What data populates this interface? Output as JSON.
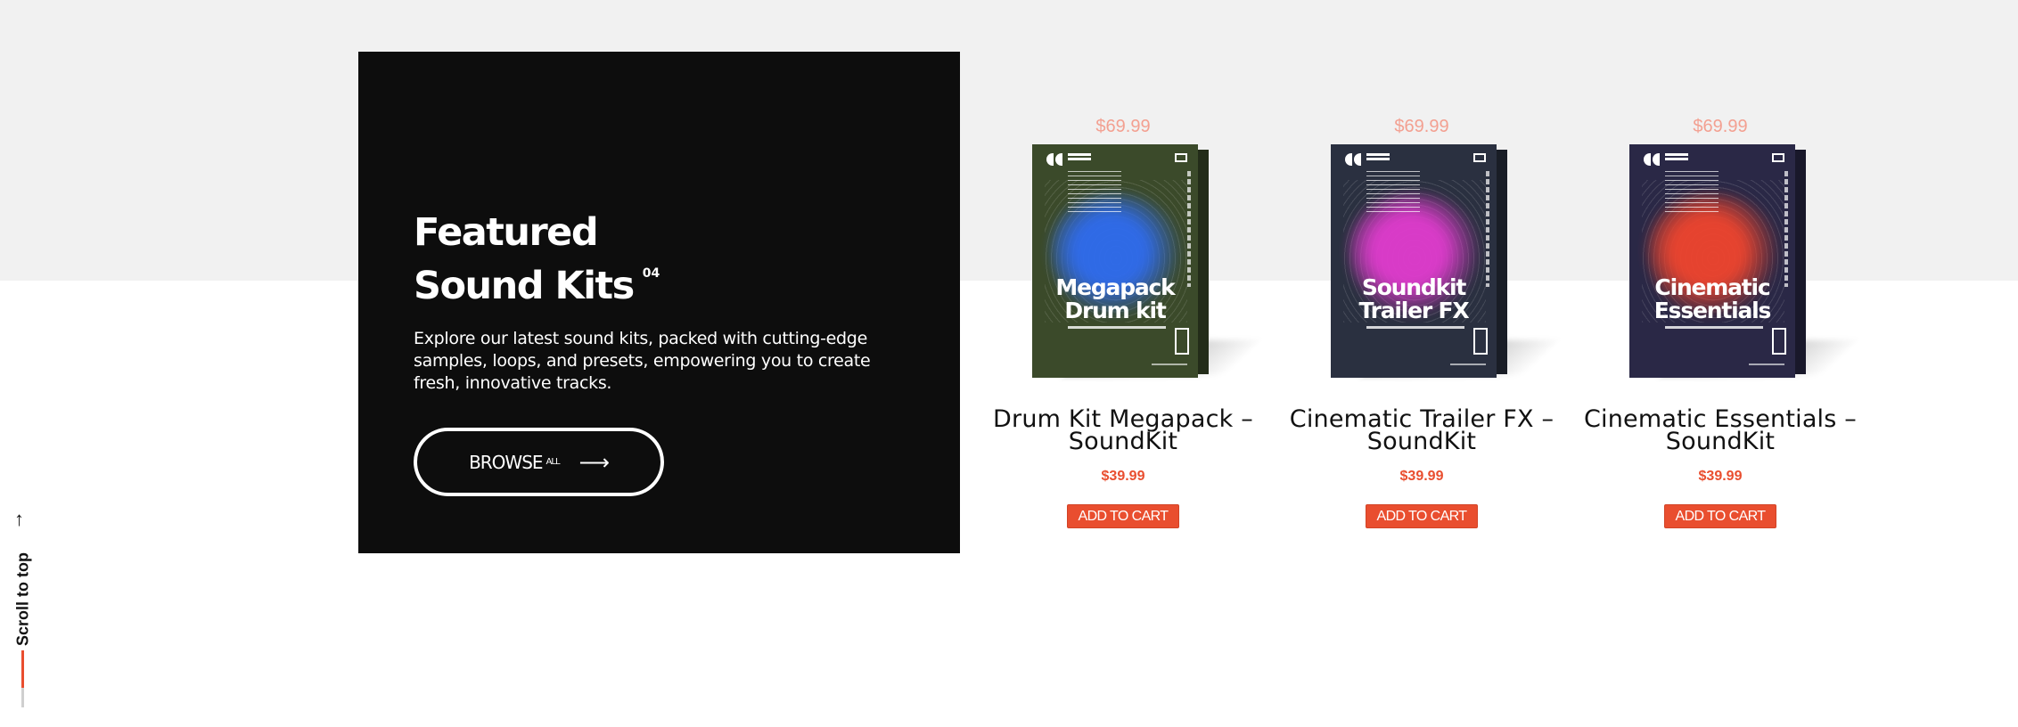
{
  "colors": {
    "accent": "#e94e2f",
    "old_price": "#f3a091",
    "panel_bg": "#0d0d0d",
    "band_bg": "#f1f1f1"
  },
  "feature": {
    "title_line1": "Featured",
    "title_line2": "Sound Kits",
    "title_count": "04",
    "description": "Explore our latest sound kits, packed with cutting-edge samples, loops, and presets, empowering you to create fresh, innovative tracks.",
    "browse_label": "BROWSE",
    "browse_sup": "ALL",
    "browse_icon": "arrow-right-icon"
  },
  "products": [
    {
      "old_price": "$69.99",
      "box_title_1": "Megapack",
      "box_title_2": "Drum kit",
      "name_line1": "Drum Kit Megapack –",
      "name_line2": "SoundKit",
      "price": "$39.99",
      "cart_label": "ADD TO CART",
      "box_bg": "#3b4a2a",
      "wave_color": "#2f6cf0"
    },
    {
      "old_price": "$69.99",
      "box_title_1": "Soundkit",
      "box_title_2": "Trailer FX",
      "name_line1": "Cinematic Trailer FX –",
      "name_line2": "SoundKit",
      "price": "$39.99",
      "cart_label": "ADD TO CART",
      "box_bg": "#2a3040",
      "wave_color": "#e23ccf"
    },
    {
      "old_price": "$69.99",
      "box_title_1": "Cinematic",
      "box_title_2": "Essentials",
      "name_line1": "Cinematic Essentials –",
      "name_line2": "SoundKit",
      "price": "$39.99",
      "cart_label": "ADD TO CART",
      "box_bg": "#2a2846",
      "wave_color": "#f0452e"
    }
  ],
  "scroll_to_top": {
    "label": "Scroll to top",
    "icon": "arrow-up-icon",
    "progress_fraction": 0.65
  }
}
